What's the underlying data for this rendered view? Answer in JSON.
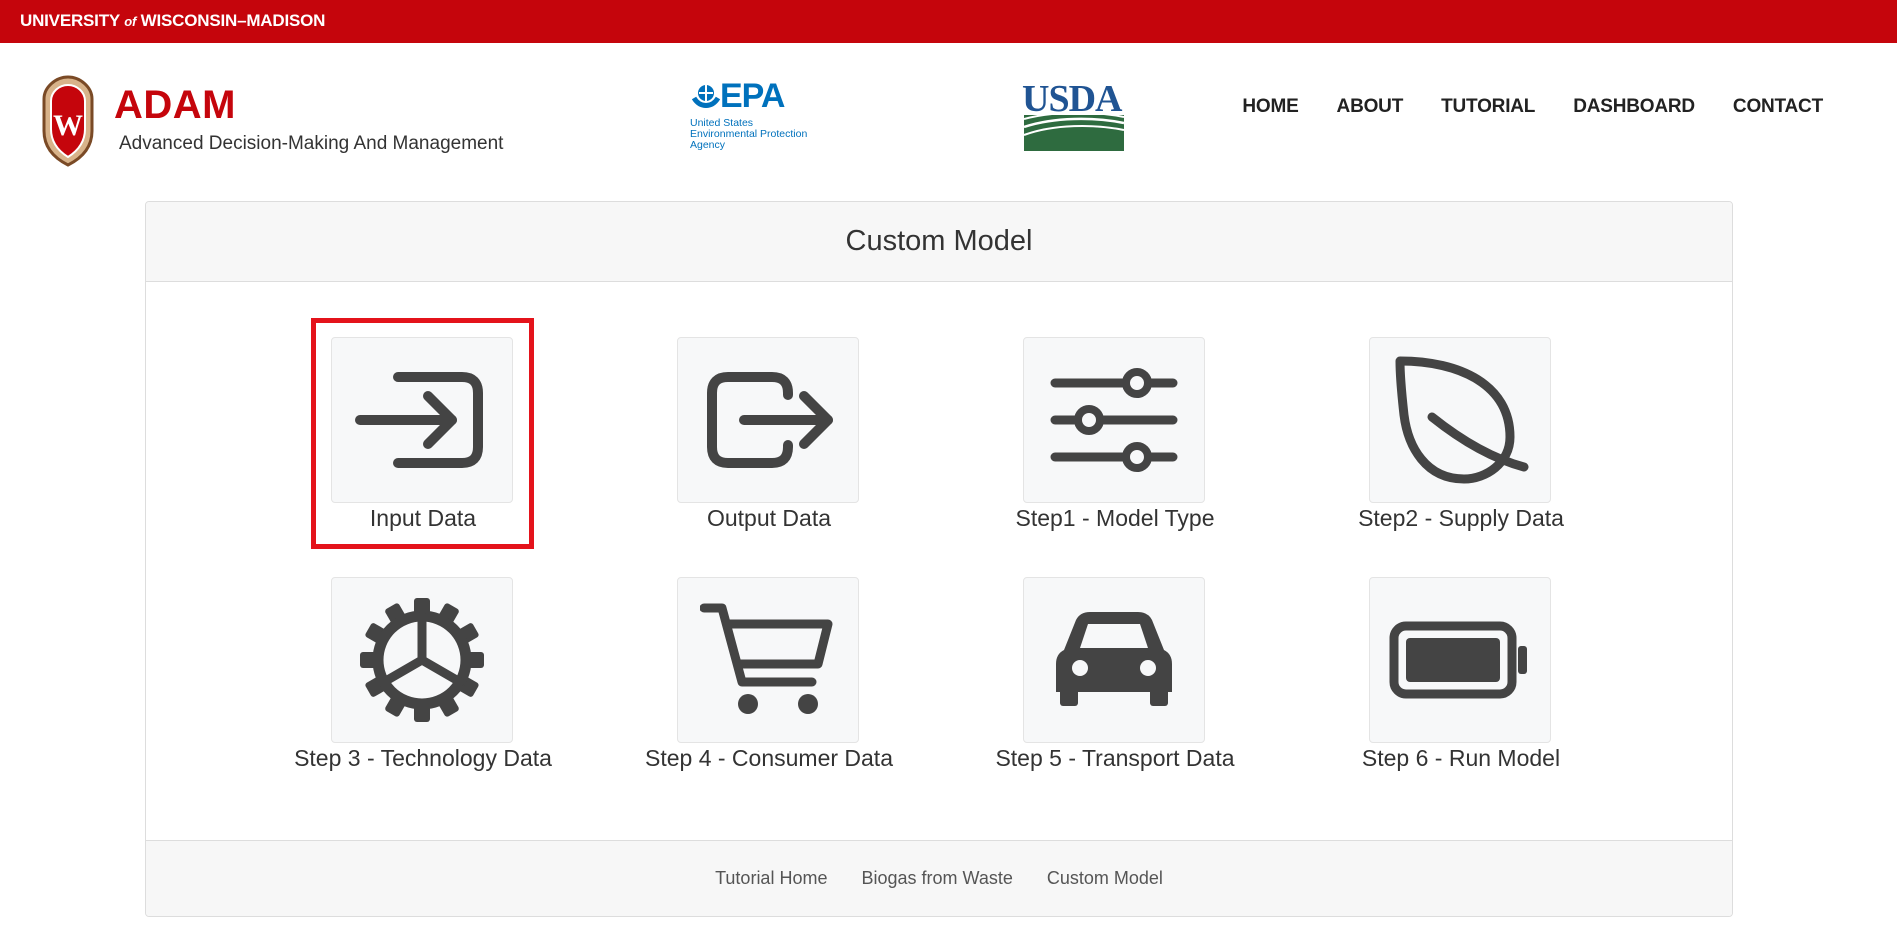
{
  "topbar": {
    "university": "UNIVERSITY",
    "of": "of",
    "campus": "WISCONSIN–MADISON"
  },
  "brand": {
    "title": "ADAM",
    "subtitle": "Advanced Decision-Making And Management"
  },
  "partners": {
    "epa": {
      "wordmark": "EPA",
      "line1": "United States",
      "line2": "Environmental Protection",
      "line3": "Agency"
    },
    "usda": {
      "wordmark": "USDA"
    }
  },
  "nav": {
    "items": [
      "HOME",
      "ABOUT",
      "TUTORIAL",
      "DASHBOARD",
      "CONTACT"
    ]
  },
  "card": {
    "title": "Custom Model",
    "tiles": [
      {
        "label": "Input Data",
        "icon": "sign-in-icon"
      },
      {
        "label": "Output Data",
        "icon": "sign-out-icon"
      },
      {
        "label": "Step1 - Model Type",
        "icon": "sliders-icon"
      },
      {
        "label": "Step2 - Supply Data",
        "icon": "leaf-icon"
      },
      {
        "label": "Step 3 - Technology Data",
        "icon": "gear-icon"
      },
      {
        "label": "Step 4 - Consumer Data",
        "icon": "cart-icon"
      },
      {
        "label": "Step 5 - Transport Data",
        "icon": "car-icon"
      },
      {
        "label": "Step 6 - Run Model",
        "icon": "battery-icon"
      }
    ],
    "highlighted_tile": "Input Data",
    "footer_links": [
      "Tutorial Home",
      "Biogas from Waste",
      "Custom Model"
    ]
  },
  "colors": {
    "brand_red": "#c5050c",
    "highlight_red": "#e4131b",
    "icon_gray": "#444444",
    "epa_blue": "#0071bc",
    "usda_blue": "#205493",
    "usda_green": "#2e6b3f"
  }
}
